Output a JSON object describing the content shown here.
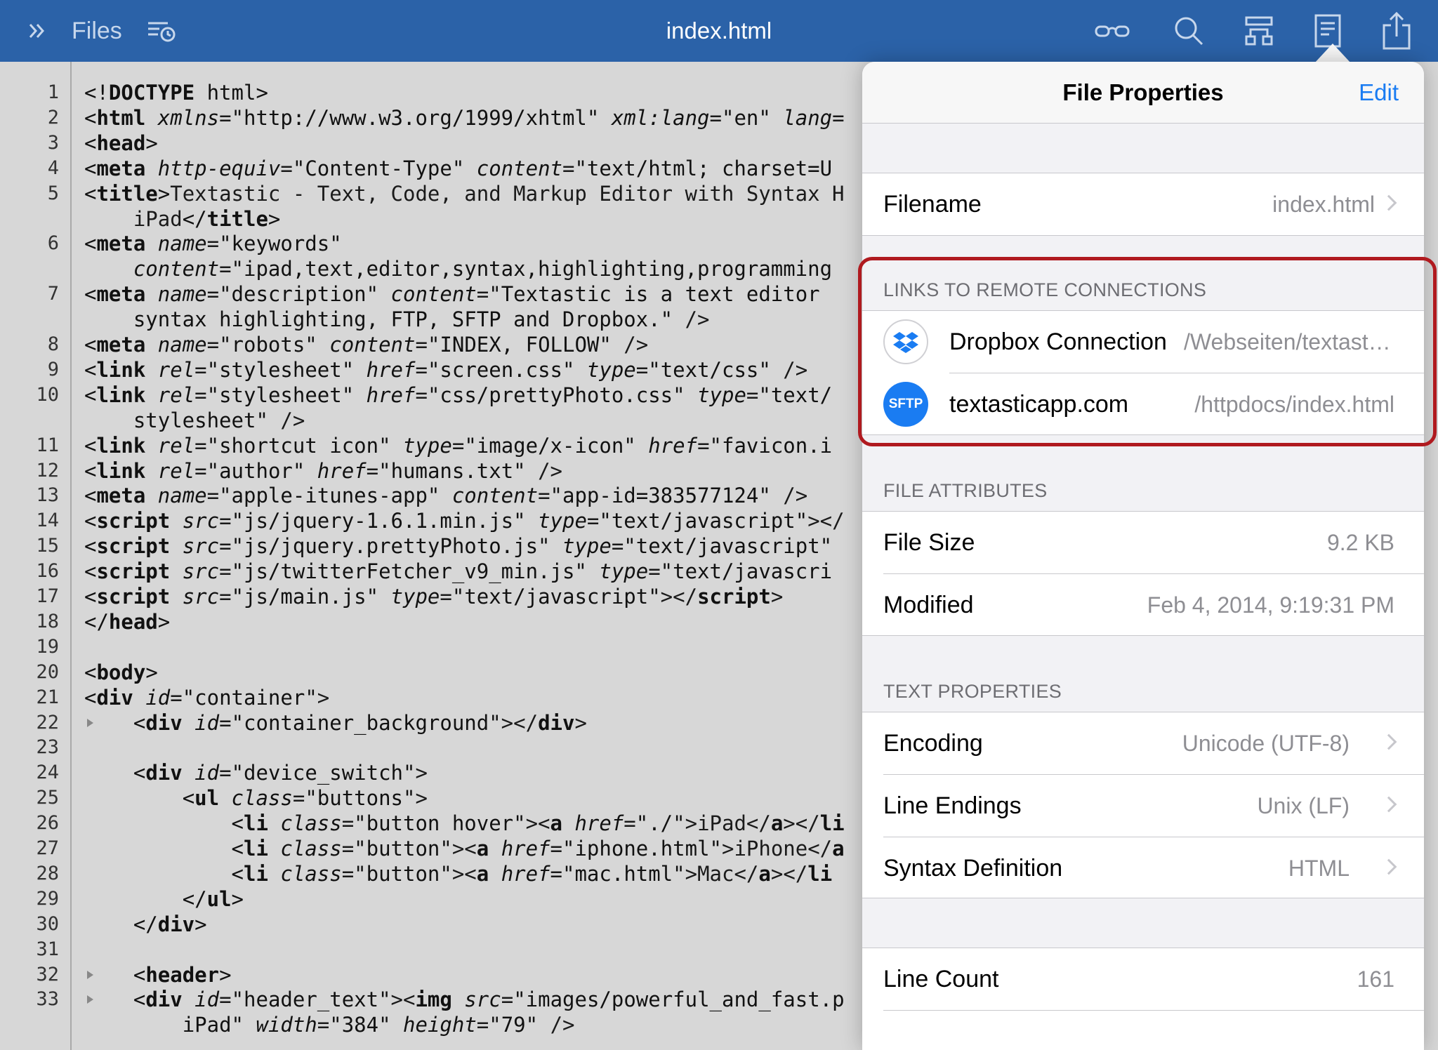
{
  "toolbar": {
    "files_label": "Files",
    "title": "index.html",
    "icons": [
      "expand-sidebar-icon",
      "recent-files-icon",
      "preview-glasses-icon",
      "search-icon",
      "symbols-icon",
      "file-info-icon",
      "share-icon"
    ],
    "accent_color": "#2b62a8"
  },
  "editor": {
    "lines": [
      {
        "n": "1",
        "html": "<span class=\"p\">&lt;!</span><span class=\"t\">DOCTYPE</span><span class=\"v\"> html</span><span class=\"p\">&gt;</span>"
      },
      {
        "n": "2",
        "html": "<span class=\"p\">&lt;</span><span class=\"t\">html</span> <span class=\"a\">xmlns</span>=<span class=\"v\">\"http://www.w3.org/1999/xhtml\"</span> <span class=\"a\">xml:lang</span>=<span class=\"v\">\"en\"</span> <span class=\"a\">lang</span>="
      },
      {
        "n": "3",
        "html": "<span class=\"p\">&lt;</span><span class=\"t\">head</span><span class=\"p\">&gt;</span>"
      },
      {
        "n": "4",
        "html": "<span class=\"p\">&lt;</span><span class=\"t\">meta</span> <span class=\"a\">http-equiv</span>=<span class=\"v\">\"Content-Type\"</span> <span class=\"a\">content</span>=<span class=\"v\">\"text/html; charset=U</span>"
      },
      {
        "n": "5",
        "html": "<span class=\"p\">&lt;</span><span class=\"t\">title</span><span class=\"p\">&gt;</span>Textastic - Text, Code, and Markup Editor with Syntax H"
      },
      {
        "n": "",
        "html": "    iPad<span class=\"p\">&lt;/</span><span class=\"t\">title</span><span class=\"p\">&gt;</span>"
      },
      {
        "n": "6",
        "html": "<span class=\"p\">&lt;</span><span class=\"t\">meta</span> <span class=\"a\">name</span>=<span class=\"v\">\"keywords\"</span>"
      },
      {
        "n": "",
        "html": "    <span class=\"a\">content</span>=<span class=\"v\">\"ipad,text,editor,syntax,highlighting,programming</span>"
      },
      {
        "n": "7",
        "html": "<span class=\"p\">&lt;</span><span class=\"t\">meta</span> <span class=\"a\">name</span>=<span class=\"v\">\"description\"</span> <span class=\"a\">content</span>=<span class=\"v\">\"Textastic is a text editor </span>"
      },
      {
        "n": "",
        "html": "    <span class=\"v\">syntax highlighting, FTP, SFTP and Dropbox.\"</span> /&gt;"
      },
      {
        "n": "8",
        "html": "<span class=\"p\">&lt;</span><span class=\"t\">meta</span> <span class=\"a\">name</span>=<span class=\"v\">\"robots\"</span> <span class=\"a\">content</span>=<span class=\"v\">\"INDEX, FOLLOW\"</span> /&gt;"
      },
      {
        "n": "9",
        "html": "<span class=\"p\">&lt;</span><span class=\"t\">link</span> <span class=\"a\">rel</span>=<span class=\"v\">\"stylesheet\"</span> <span class=\"a\">href</span>=<span class=\"v\">\"screen.css\"</span> <span class=\"a\">type</span>=<span class=\"v\">\"text/css\"</span> /&gt;"
      },
      {
        "n": "10",
        "html": "<span class=\"p\">&lt;</span><span class=\"t\">link</span> <span class=\"a\">rel</span>=<span class=\"v\">\"stylesheet\"</span> <span class=\"a\">href</span>=<span class=\"v\">\"css/prettyPhoto.css\"</span> <span class=\"a\">type</span>=<span class=\"v\">\"text/</span>"
      },
      {
        "n": "",
        "html": "    <span class=\"v\">stylesheet\"</span> /&gt;"
      },
      {
        "n": "11",
        "html": "<span class=\"p\">&lt;</span><span class=\"t\">link</span> <span class=\"a\">rel</span>=<span class=\"v\">\"shortcut icon\"</span> <span class=\"a\">type</span>=<span class=\"v\">\"image/x-icon\"</span> <span class=\"a\">href</span>=<span class=\"v\">\"favicon.i</span>"
      },
      {
        "n": "12",
        "html": "<span class=\"p\">&lt;</span><span class=\"t\">link</span> <span class=\"a\">rel</span>=<span class=\"v\">\"author\"</span> <span class=\"a\">href</span>=<span class=\"v\">\"humans.txt\"</span> /&gt;"
      },
      {
        "n": "13",
        "html": "<span class=\"p\">&lt;</span><span class=\"t\">meta</span> <span class=\"a\">name</span>=<span class=\"v\">\"apple-itunes-app\"</span> <span class=\"a\">content</span>=<span class=\"v\">\"app-id=383577124\"</span> /&gt;"
      },
      {
        "n": "14",
        "html": "<span class=\"p\">&lt;</span><span class=\"t\">script</span> <span class=\"a\">src</span>=<span class=\"v\">\"js/jquery-1.6.1.min.js\"</span> <span class=\"a\">type</span>=<span class=\"v\">\"text/javascript\"</span>&gt;&lt;/"
      },
      {
        "n": "15",
        "html": "<span class=\"p\">&lt;</span><span class=\"t\">script</span> <span class=\"a\">src</span>=<span class=\"v\">\"js/jquery.prettyPhoto.js\"</span> <span class=\"a\">type</span>=<span class=\"v\">\"text/javascript\"</span>"
      },
      {
        "n": "16",
        "html": "<span class=\"p\">&lt;</span><span class=\"t\">script</span> <span class=\"a\">src</span>=<span class=\"v\">\"js/twitterFetcher_v9_min.js\"</span> <span class=\"a\">type</span>=<span class=\"v\">\"text/javascri</span>"
      },
      {
        "n": "17",
        "html": "<span class=\"p\">&lt;</span><span class=\"t\">script</span> <span class=\"a\">src</span>=<span class=\"v\">\"js/main.js\"</span> <span class=\"a\">type</span>=<span class=\"v\">\"text/javascript\"</span>&gt;&lt;/<span class=\"t\">script</span>&gt;"
      },
      {
        "n": "18",
        "html": "<span class=\"p\">&lt;/</span><span class=\"t\">head</span><span class=\"p\">&gt;</span>"
      },
      {
        "n": "19",
        "html": ""
      },
      {
        "n": "20",
        "html": "<span class=\"p\">&lt;</span><span class=\"t\">body</span><span class=\"p\">&gt;</span>"
      },
      {
        "n": "21",
        "html": "<span class=\"p\">&lt;</span><span class=\"t\">div</span> <span class=\"a\">id</span>=<span class=\"v\">\"container\"</span>&gt;"
      },
      {
        "n": "22",
        "html": "    <span class=\"p\">&lt;</span><span class=\"t\">div</span> <span class=\"a\">id</span>=<span class=\"v\">\"container_background\"</span>&gt;&lt;/<span class=\"t\">div</span>&gt;",
        "fold": true
      },
      {
        "n": "23",
        "html": ""
      },
      {
        "n": "24",
        "html": "    <span class=\"p\">&lt;</span><span class=\"t\">div</span> <span class=\"a\">id</span>=<span class=\"v\">\"device_switch\"</span>&gt;"
      },
      {
        "n": "25",
        "html": "        <span class=\"p\">&lt;</span><span class=\"t\">ul</span> <span class=\"a\">class</span>=<span class=\"v\">\"buttons\"</span>&gt;"
      },
      {
        "n": "26",
        "html": "            <span class=\"p\">&lt;</span><span class=\"t\">li</span> <span class=\"a\">class</span>=<span class=\"v\">\"button hover\"</span>&gt;&lt;<span class=\"t\">a</span> <span class=\"a\">href</span>=<span class=\"v\">\"./\"</span>&gt;iPad&lt;/<span class=\"t\">a</span>&gt;&lt;/<span class=\"t\">li</span>"
      },
      {
        "n": "27",
        "html": "            <span class=\"p\">&lt;</span><span class=\"t\">li</span> <span class=\"a\">class</span>=<span class=\"v\">\"button\"</span>&gt;&lt;<span class=\"t\">a</span> <span class=\"a\">href</span>=<span class=\"v\">\"iphone.html\"</span>&gt;iPhone&lt;/<span class=\"t\">a</span>"
      },
      {
        "n": "28",
        "html": "            <span class=\"p\">&lt;</span><span class=\"t\">li</span> <span class=\"a\">class</span>=<span class=\"v\">\"button\"</span>&gt;&lt;<span class=\"t\">a</span> <span class=\"a\">href</span>=<span class=\"v\">\"mac.html\"</span>&gt;Mac&lt;/<span class=\"t\">a</span>&gt;&lt;/<span class=\"t\">li</span>"
      },
      {
        "n": "29",
        "html": "        <span class=\"p\">&lt;/</span><span class=\"t\">ul</span><span class=\"p\">&gt;</span>"
      },
      {
        "n": "30",
        "html": "    <span class=\"p\">&lt;/</span><span class=\"t\">div</span><span class=\"p\">&gt;</span>"
      },
      {
        "n": "31",
        "html": ""
      },
      {
        "n": "32",
        "html": "    <span class=\"p\">&lt;</span><span class=\"t\">header</span><span class=\"p\">&gt;</span>",
        "fold": true
      },
      {
        "n": "33",
        "html": "    <span class=\"p\">&lt;</span><span class=\"t\">div</span> <span class=\"a\">id</span>=<span class=\"v\">\"header_text\"</span>&gt;&lt;<span class=\"t\">img</span> <span class=\"a\">src</span>=<span class=\"v\">\"images/powerful_and_fast.p</span>",
        "fold": true
      },
      {
        "n": "",
        "html": "        <span class=\"v\">iPad\"</span> <span class=\"a\">width</span>=<span class=\"v\">\"384\"</span> <span class=\"a\">height</span>=<span class=\"v\">\"79\"</span> /&gt;"
      }
    ]
  },
  "popover": {
    "title": "File Properties",
    "edit_label": "Edit",
    "filename": {
      "label": "Filename",
      "value": "index.html"
    },
    "remote_header": "LINKS TO REMOTE CONNECTIONS",
    "connections": [
      {
        "name": "Dropbox Connection",
        "path": "/Webseiten/textastic/index.html",
        "icon": "dropbox-icon"
      },
      {
        "name": "textasticapp.com",
        "path": "/httpdocs/index.html",
        "icon": "sftp-icon",
        "badge": "SFTP"
      }
    ],
    "attributes_header": "FILE ATTRIBUTES",
    "file_size": {
      "label": "File Size",
      "value": "9.2 KB"
    },
    "modified": {
      "label": "Modified",
      "value": "Feb 4, 2014, 9:19:31 PM"
    },
    "text_header": "TEXT PROPERTIES",
    "encoding": {
      "label": "Encoding",
      "value": "Unicode (UTF-8)"
    },
    "line_endings": {
      "label": "Line Endings",
      "value": "Unix (LF)"
    },
    "syntax": {
      "label": "Syntax Definition",
      "value": "HTML"
    },
    "line_count": {
      "label": "Line Count",
      "value": "161"
    },
    "highlight_color": "#b01a1f",
    "link_color": "#1a7cf2"
  }
}
